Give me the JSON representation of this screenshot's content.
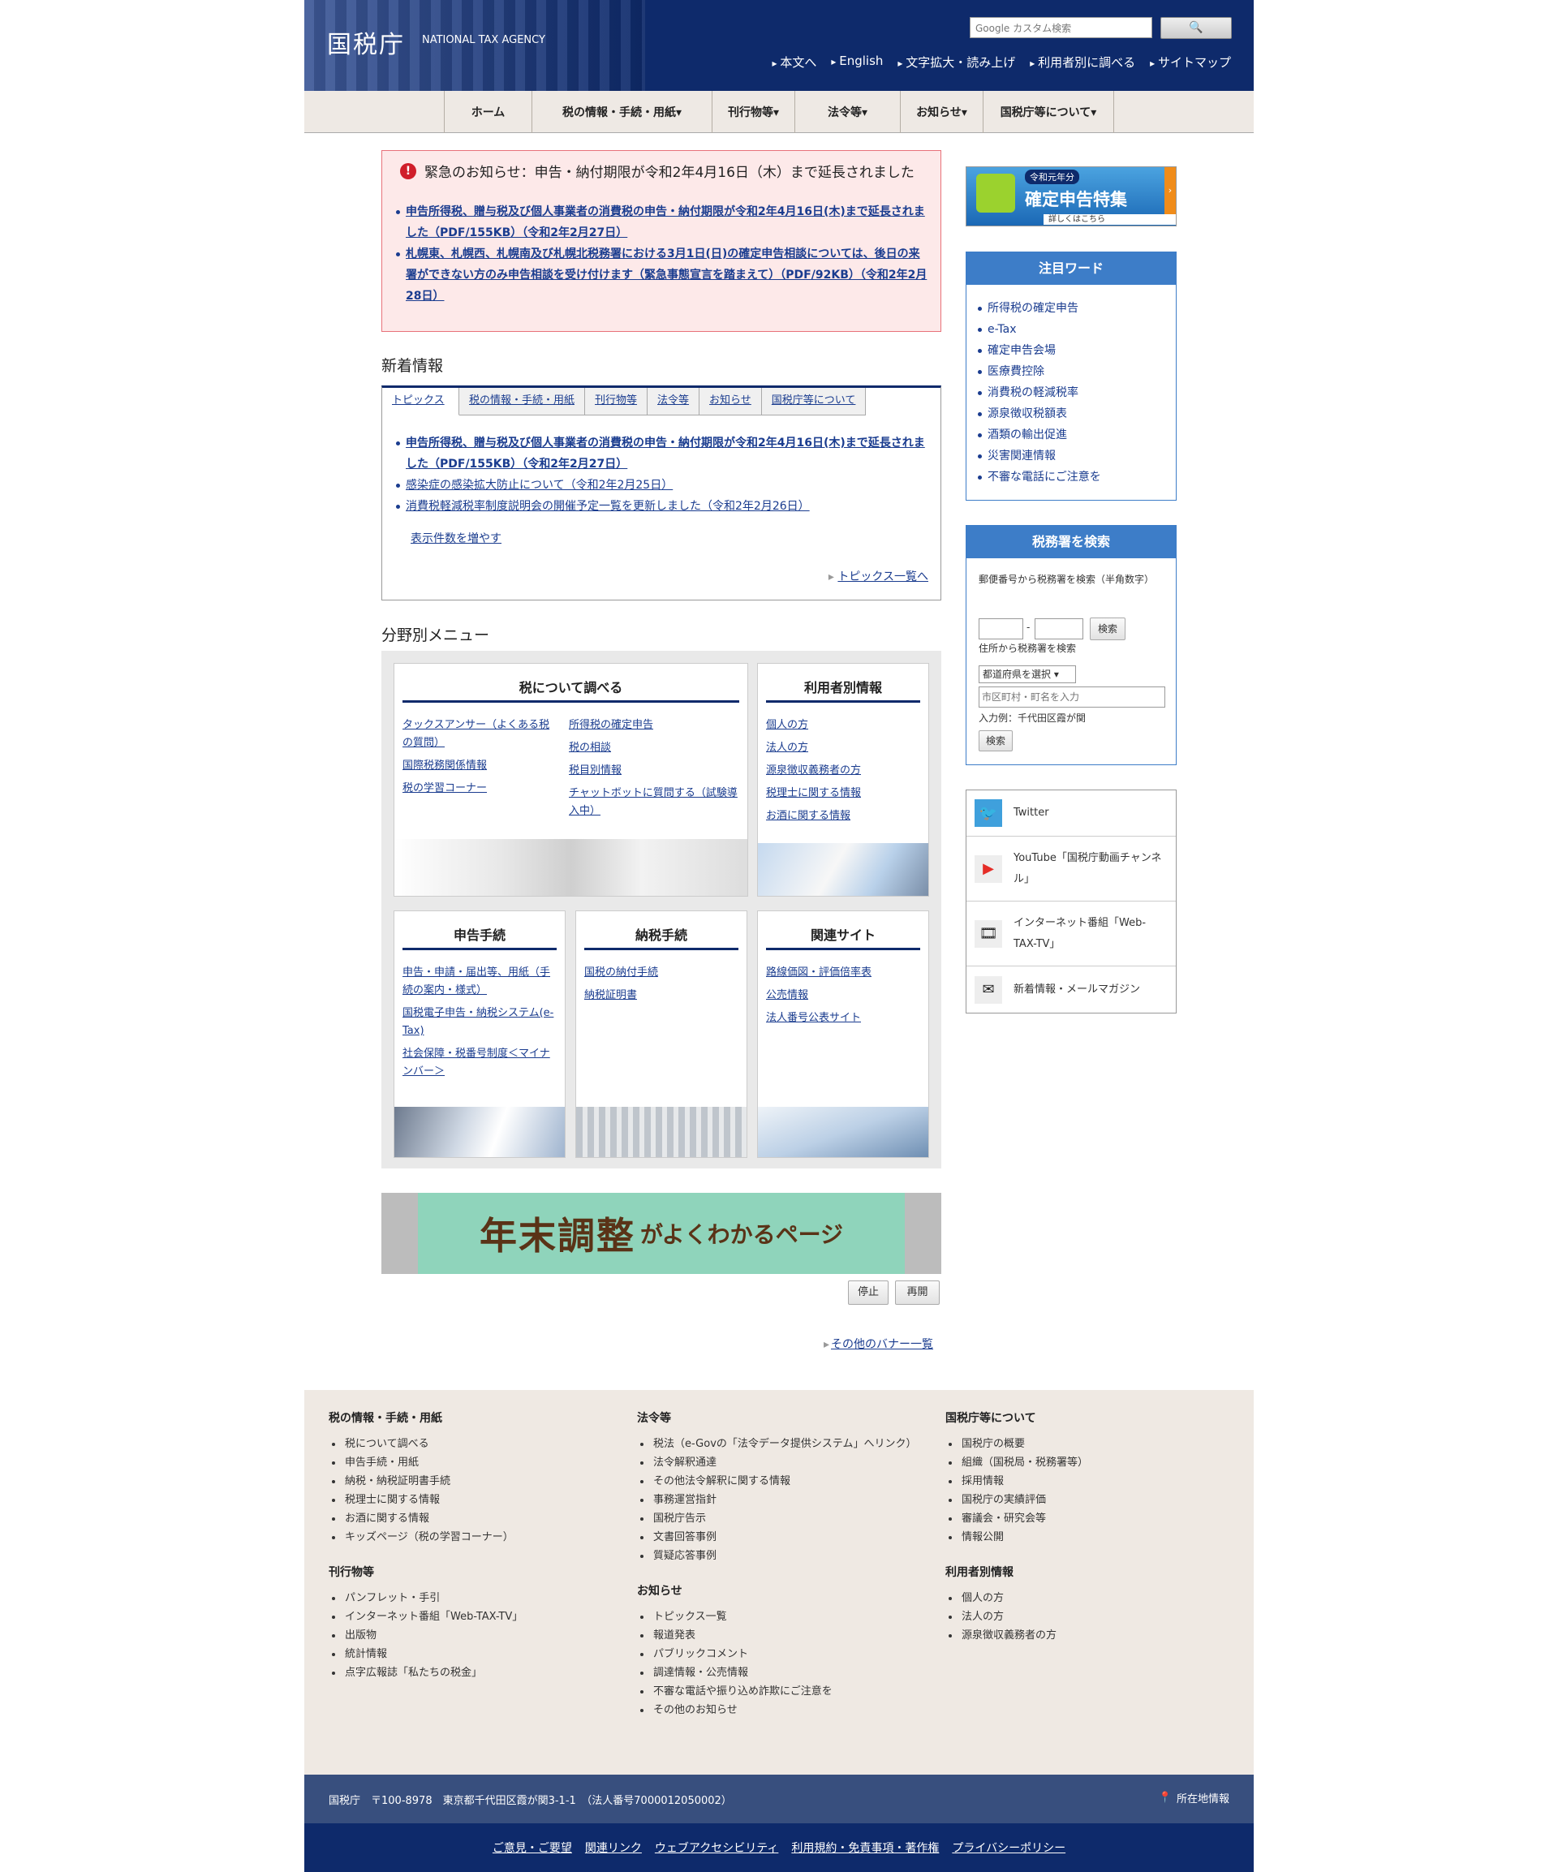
{
  "header": {
    "logo_jp": "国税庁",
    "logo_en": "NATIONAL TAX AGENCY",
    "search_placeholder": "Google カスタム検索",
    "search_button": "🔍",
    "top_links": [
      "本文へ",
      "English",
      "文字拡大・読み上げ",
      "利用者別に調べる",
      "サイトマップ"
    ]
  },
  "nav": [
    {
      "label": "ホーム"
    },
    {
      "label": "税の情報・手続・用紙▾"
    },
    {
      "label": "刊行物等▾"
    },
    {
      "label": "法令等▾"
    },
    {
      "label": "お知らせ▾"
    },
    {
      "label": "国税庁等について▾"
    }
  ],
  "alert": {
    "icon": "!",
    "title": "緊急のお知らせ：申告・納付期限が令和2年4月16日（木）まで延長されました",
    "items": [
      "申告所得税、贈与税及び個人事業者の消費税の申告・納付期限が令和2年4月16日(木)まで延長されました（PDF/155KB）（令和2年2月27日）",
      "札幌東、札幌西、札幌南及び札幌北税務署における3月1日(日)の確定申告相談については、後日の来署ができない方のみ申告相談を受け付けます（緊急事態宣言を踏まえて）（PDF/92KB）（令和2年2月28日）"
    ]
  },
  "news": {
    "heading": "新着情報",
    "tabs": [
      "トピックス",
      "税の情報・手続・用紙",
      "刊行物等",
      "法令等",
      "お知らせ",
      "国税庁等について"
    ],
    "items": [
      "申告所得税、贈与税及び個人事業者の消費税の申告・納付期限が令和2年4月16日(木)まで延長されました（PDF/155KB）（令和2年2月27日）",
      "感染症の感染拡大防止について（令和2年2月25日）",
      "消費税軽減税率制度説明会の開催予定一覧を更新しました（令和2年2月26日）"
    ],
    "more_count": "表示件数を増やす",
    "all_link": "トピックス一覧へ"
  },
  "menu": {
    "heading": "分野別メニュー",
    "research": {
      "title": "税について調べる",
      "left": [
        "タックスアンサー（よくある税の質問）",
        "国際税務関係情報",
        "税の学習コーナー"
      ],
      "right": [
        "所得税の確定申告",
        "税の相談",
        "税目別情報",
        "チャットボットに質問する（試験導入中）"
      ]
    },
    "user": {
      "title": "利用者別情報",
      "links": [
        "個人の方",
        "法人の方",
        "源泉徴収義務者の方",
        "税理士に関する情報",
        "お酒に関する情報"
      ]
    },
    "filing": {
      "title": "申告手続",
      "links": [
        "申告・申請・届出等、用紙（手続の案内・様式）",
        "国税電子申告・納税システム(e-Tax)",
        "社会保障・税番号制度＜マイナンバー＞"
      ]
    },
    "payment": {
      "title": "納税手続",
      "links": [
        "国税の納付手続",
        "納税証明書"
      ]
    },
    "related": {
      "title": "関連サイト",
      "links": [
        "路線価図・評価倍率表",
        "公売情報",
        "法人番号公表サイト"
      ]
    }
  },
  "banner": {
    "text_big": "年末調整",
    "text_small": "がよくわかるページ",
    "stop": "停止",
    "resume": "再開",
    "other": "その他のバナー一覧"
  },
  "sidebar": {
    "kakutei": {
      "tag": "令和元年分",
      "main": "確定申告特集",
      "sub": "詳しくはこちら"
    },
    "keywords": {
      "title": "注目ワード",
      "items": [
        "所得税の確定申告",
        "e-Tax",
        "確定申告会場",
        "医療費控除",
        "消費税の軽減税率",
        "源泉徴収税額表",
        "酒類の輸出促進",
        "災害関連情報",
        "不審な電話にご注意を"
      ]
    },
    "office_search": {
      "title": "税務署を検索",
      "postal_label": "郵便番号から税務署を検索（半角数字）",
      "dash": "-",
      "search_btn": "検索",
      "address_label": "住所から税務署を検索",
      "pref_select": "都道府県を選択",
      "city_placeholder": "市区町村・町名を入力",
      "example": "入力例：千代田区霞が関",
      "search_btn2": "検索"
    },
    "social": [
      {
        "icon": "twitter-icon",
        "label": "Twitter"
      },
      {
        "icon": "youtube-icon",
        "label": "YouTube「国税庁動画チャンネル」"
      },
      {
        "icon": "film-icon",
        "label": "インターネット番組「Web-TAX-TV」"
      },
      {
        "icon": "mail-icon",
        "label": "新着情報・メールマガジン"
      }
    ]
  },
  "footer": {
    "col1": [
      {
        "title": "税の情報・手続・用紙",
        "items": [
          "税について調べる",
          "申告手続・用紙",
          "納税・納税証明書手続",
          "税理士に関する情報",
          "お酒に関する情報",
          "キッズページ（税の学習コーナー）"
        ]
      },
      {
        "title": "刊行物等",
        "items": [
          "パンフレット・手引",
          "インターネット番組「Web-TAX-TV」",
          "出版物",
          "統計情報",
          "点字広報誌「私たちの税金」"
        ]
      }
    ],
    "col2": [
      {
        "title": "法令等",
        "items": [
          "税法（e-Govの「法令データ提供システム」へリンク）",
          "法令解釈通達",
          "その他法令解釈に関する情報",
          "事務運営指針",
          "国税庁告示",
          "文書回答事例",
          "質疑応答事例"
        ]
      },
      {
        "title": "お知らせ",
        "items": [
          "トピックス一覧",
          "報道発表",
          "パブリックコメント",
          "調達情報・公売情報",
          "不審な電話や振り込め詐欺にご注意を",
          "その他のお知らせ"
        ]
      }
    ],
    "col3": [
      {
        "title": "国税庁等について",
        "items": [
          "国税庁の概要",
          "組織（国税局・税務署等）",
          "採用情報",
          "国税庁の実績評価",
          "審議会・研究会等",
          "情報公開"
        ]
      },
      {
        "title": "利用者別情報",
        "items": [
          "個人の方",
          "法人の方",
          "源泉徴収義務者の方"
        ]
      }
    ],
    "address": "国税庁　〒100-8978　東京都千代田区霞が関3-1-1　（法人番号7000012050002）",
    "location": "所在地情報",
    "bottom_links": [
      "ご意見・ご要望",
      "関連リンク",
      "ウェブアクセシビリティ",
      "利用規約・免責事項・著作権",
      "プライバシーポリシー"
    ]
  }
}
